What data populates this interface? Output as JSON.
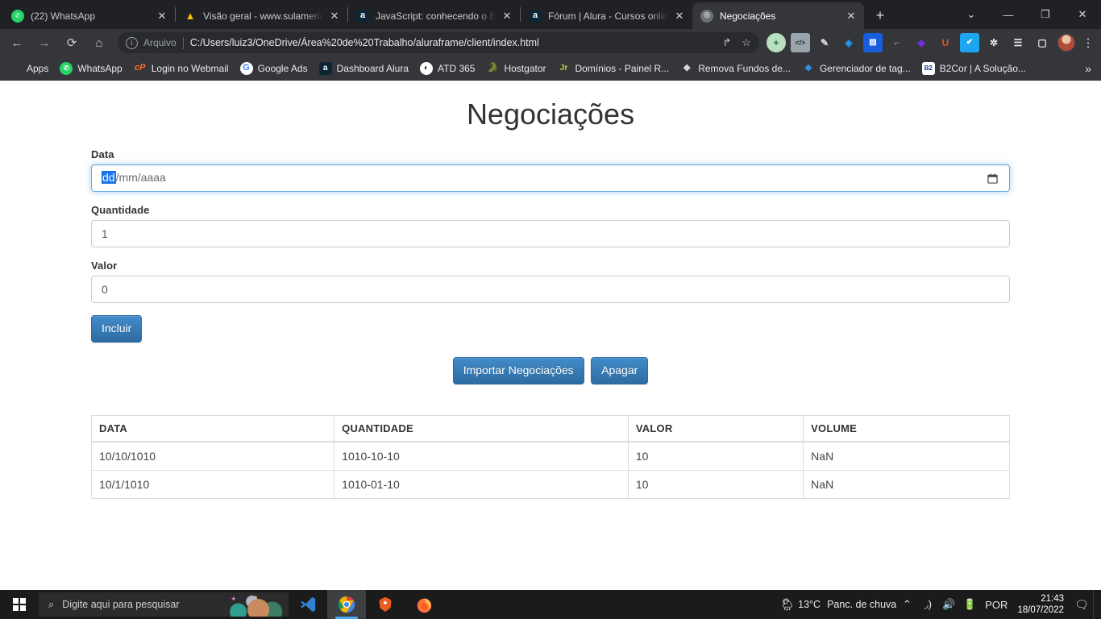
{
  "browser": {
    "tabs": [
      {
        "title": "(22) WhatsApp",
        "favicon": "whatsapp-icon",
        "active": false
      },
      {
        "title": "Visão geral - www.sulamerica",
        "favicon": "google-ads-icon",
        "active": false
      },
      {
        "title": "JavaScript: conhecendo o Bro",
        "favicon": "alura-icon",
        "active": false
      },
      {
        "title": "Fórum | Alura - Cursos online",
        "favicon": "alura-icon",
        "active": false
      },
      {
        "title": "Negociações",
        "favicon": "globe-icon",
        "active": true
      }
    ],
    "new_tab_label": "+",
    "close_label": "✕",
    "window_controls": {
      "expand": "⌄",
      "minimize": "—",
      "maximize": "❐",
      "close": "✕"
    },
    "toolbar": {
      "back_label": "←",
      "forward_label": "→",
      "reload_label": "⟳",
      "home_label": "⌂",
      "scheme_label": "Arquivo",
      "url": "C:/Users/luiz3/OneDrive/Área%20de%20Trabalho/aluraframe/client/index.html",
      "share_label": "↱",
      "bookmark_star_label": "☆",
      "menu_label": "⋮",
      "extensions": [
        {
          "name": "add-extension-icon",
          "glyph": "+",
          "bg": "#b8e0c0",
          "fg": "#1d6b33"
        },
        {
          "name": "code-extension-icon",
          "glyph": "</>",
          "bg": "#9aa4ad",
          "fg": "#2b3138"
        },
        {
          "name": "colorpick-extension-icon",
          "glyph": "✎",
          "bg": "#00000000",
          "fg": "#d8d8d8"
        },
        {
          "name": "tag-extension-icon",
          "glyph": "◈",
          "bg": "#00000000",
          "fg": "#2196f3"
        },
        {
          "name": "bitwarden-extension-icon",
          "glyph": "▤",
          "bg": "#175ddc",
          "fg": "#ffffff"
        },
        {
          "name": "tools-extension-icon",
          "glyph": "⌐",
          "bg": "#00000000",
          "fg": "#8a9099"
        },
        {
          "name": "diamond-extension-icon",
          "glyph": "◆",
          "bg": "#00000000",
          "fg": "#6f2ee0"
        },
        {
          "name": "ublock-extension-icon",
          "glyph": "U",
          "bg": "#00000000",
          "fg": "#e8520e"
        },
        {
          "name": "grammar-extension-icon",
          "glyph": "✔",
          "bg": "#1ea5ef",
          "fg": "#ffffff"
        },
        {
          "name": "puzzle-extensions-icon",
          "glyph": "🧩",
          "bg": "#00000000",
          "fg": "#e8eaed"
        },
        {
          "name": "playlist-extension-icon",
          "glyph": "☰",
          "bg": "#00000000",
          "fg": "#e8eaed"
        },
        {
          "name": "sidepanel-icon",
          "glyph": "▢",
          "bg": "#00000000",
          "fg": "#e8eaed"
        }
      ]
    },
    "bookmarks": [
      {
        "label": "Apps",
        "icon": "apps-grid-icon"
      },
      {
        "label": "WhatsApp",
        "icon": "whatsapp-icon"
      },
      {
        "label": "Login no Webmail",
        "icon": "cpanel-icon"
      },
      {
        "label": "Google Ads",
        "icon": "google-icon"
      },
      {
        "label": "Dashboard Alura",
        "icon": "alura-icon"
      },
      {
        "label": "ATD 365",
        "icon": "atd-icon"
      },
      {
        "label": "Hostgator",
        "icon": "hostgator-icon"
      },
      {
        "label": "Domínios - Painel R...",
        "icon": "registro-icon"
      },
      {
        "label": "Remova Fundos de...",
        "icon": "removebg-icon"
      },
      {
        "label": "Gerenciador de tag...",
        "icon": "gtm-icon"
      },
      {
        "label": "B2Cor | A Solução...",
        "icon": "b2cor-icon"
      }
    ],
    "bookmarks_overflow_label": "»"
  },
  "page": {
    "title": "Negociações",
    "form": {
      "date": {
        "label": "Data",
        "value_day": "dd",
        "value_rest": "/mm/aaaa",
        "placeholder": "dd/mm/aaaa",
        "calendar_icon": "calendar-icon"
      },
      "quantity": {
        "label": "Quantidade",
        "value": "1"
      },
      "value": {
        "label": "Valor",
        "value": "0"
      },
      "submit_label": "Incluir"
    },
    "actions": {
      "import_label": "Importar Negociações",
      "clear_label": "Apagar"
    },
    "table": {
      "columns": [
        "DATA",
        "QUANTIDADE",
        "VALOR",
        "VOLUME"
      ],
      "rows": [
        [
          "10/10/1010",
          "1010-10-10",
          "10",
          "NaN"
        ],
        [
          "10/1/1010",
          "1010-01-10",
          "10",
          "NaN"
        ]
      ]
    },
    "colors": {
      "primary_button": "#428bca",
      "primary_button_border": "#2d6ca2",
      "focus_border": "#66afe9",
      "date_selection": "#1a73e8"
    }
  },
  "taskbar": {
    "start_label": "Start",
    "search_placeholder": "Digite aqui para pesquisar",
    "apps": [
      {
        "name": "vscode",
        "active": false
      },
      {
        "name": "chrome",
        "active": true
      },
      {
        "name": "brave",
        "active": false
      },
      {
        "name": "firefox",
        "active": false
      }
    ],
    "weather": {
      "temperature": "13°C",
      "condition": "Panc. de chuva",
      "icon": "rain-cloud-icon"
    },
    "tray": {
      "chevron": "⌃",
      "network_icon": "wifi-icon",
      "volume_icon": "speaker-icon",
      "battery_icon": "battery-icon",
      "language": "POR"
    },
    "clock": {
      "time": "21:43",
      "date": "18/07/2022"
    },
    "notifications_icon": "notification-icon"
  }
}
